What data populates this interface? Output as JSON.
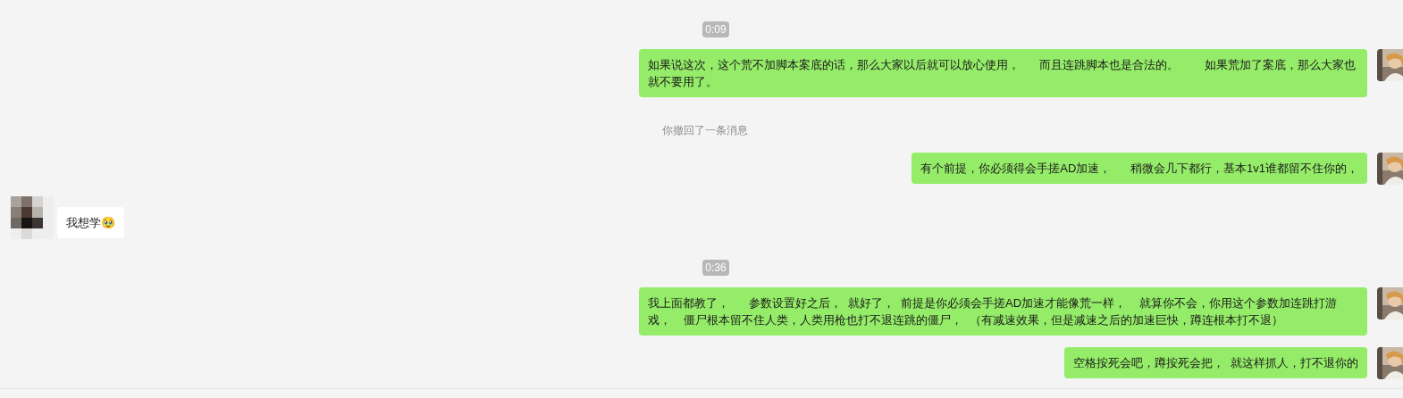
{
  "messages": [
    {
      "kind": "time",
      "text": "0:09"
    },
    {
      "kind": "sent",
      "text": "如果说这次，这个荒不加脚本案底的话，那么大家以后就可以放心使用，      而且连跳脚本也是合法的。        如果荒加了案底，那么大家也就不要用了。"
    },
    {
      "kind": "recall",
      "text": "你撤回了一条消息"
    },
    {
      "kind": "sent",
      "text": "有个前提，你必须得会手搓AD加速，      稍微会几下都行，基本1v1谁都留不住你的，"
    },
    {
      "kind": "received",
      "text": "我想学🥹"
    },
    {
      "kind": "time",
      "text": "0:36"
    },
    {
      "kind": "sent",
      "text": "我上面都教了，      参数设置好之后，  就好了，  前提是你必须会手搓AD加速才能像荒一样，    就算你不会，你用这个参数加连跳打游戏，    僵尸根本留不住人类，人类用枪也打不退连跳的僵尸，  （有减速效果，但是减速之后的加速巨快，蹲连根本打不退）"
    },
    {
      "kind": "sent",
      "text": "空格按死会吧，蹲按死会把，  就这样抓人，打不退你的"
    }
  ]
}
